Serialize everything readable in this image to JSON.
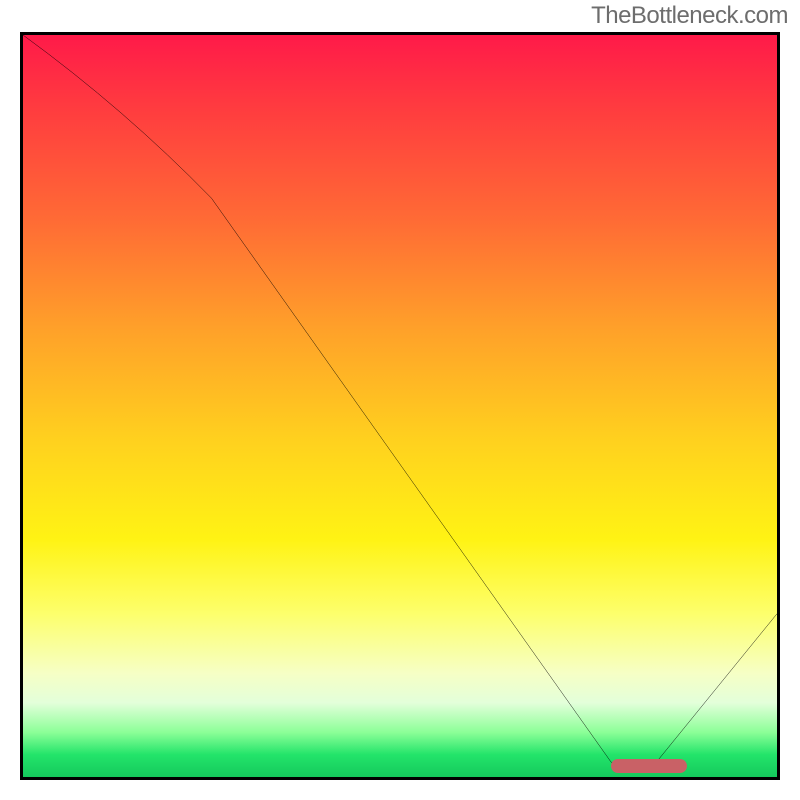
{
  "watermark": "TheBottleneck.com",
  "chart_data": {
    "type": "line",
    "title": "",
    "xlabel": "",
    "ylabel": "",
    "xlim": [
      0,
      100
    ],
    "ylim": [
      0,
      100
    ],
    "x": [
      0,
      25,
      78,
      84,
      100
    ],
    "values": [
      100,
      78,
      2,
      2,
      22
    ],
    "optimal_range": {
      "x_start": 78,
      "x_end": 88,
      "y": 1.5
    },
    "gradient_stops": [
      {
        "pct": 0,
        "color": "#ff1a49"
      },
      {
        "pct": 25,
        "color": "#ff6b35"
      },
      {
        "pct": 55,
        "color": "#ffd21e"
      },
      {
        "pct": 86,
        "color": "#f6ffc5"
      },
      {
        "pct": 100,
        "color": "#14c95c"
      }
    ]
  }
}
